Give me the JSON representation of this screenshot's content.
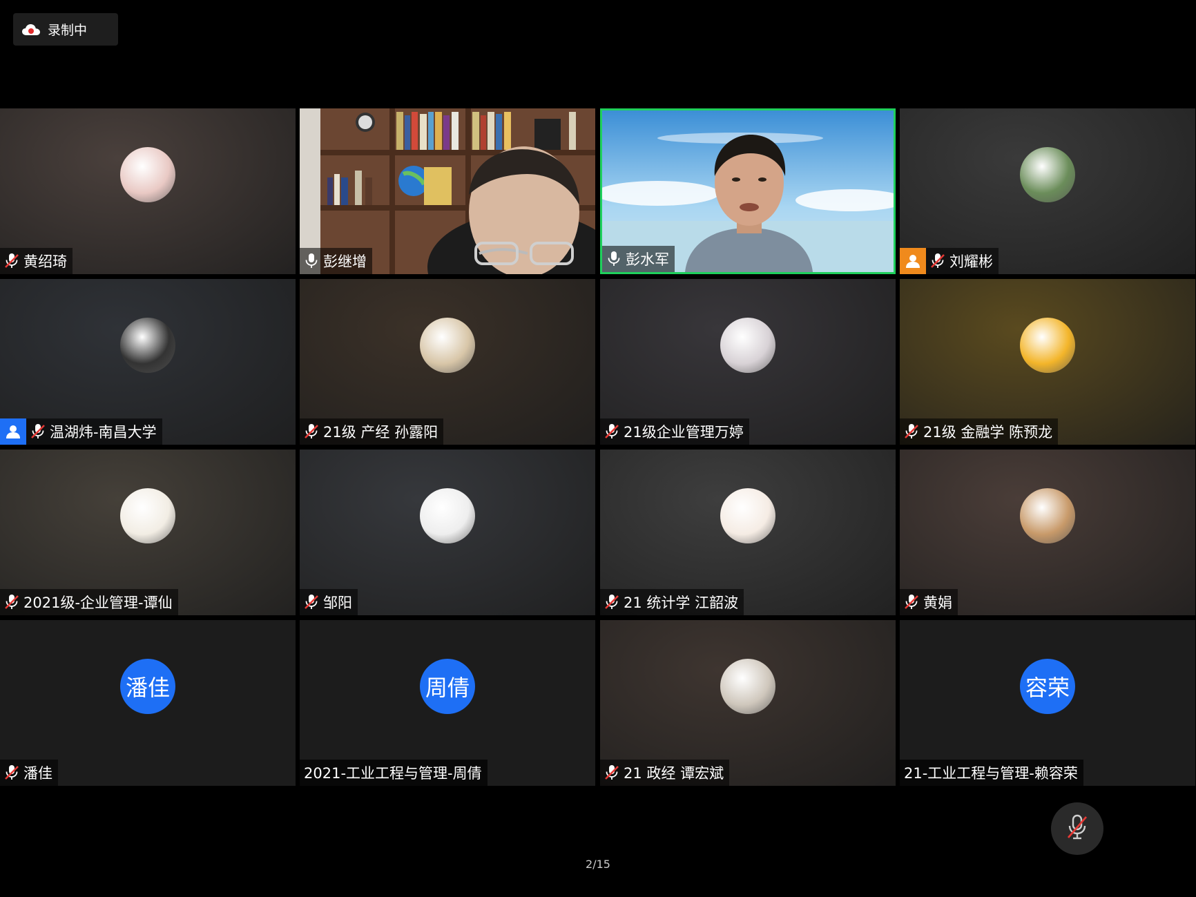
{
  "recording": {
    "label": "录制中",
    "icon": "cloud-record-icon",
    "accent": "#e02b2b"
  },
  "active_speaker_color": "#1fd05c",
  "tiles": [
    {
      "name": "黄绍琦",
      "mic": "muted",
      "kind": "avatar",
      "bg": "#4a403c",
      "avatar_color": "#e9c9c4",
      "role": ""
    },
    {
      "name": "彭继增",
      "mic": "on",
      "kind": "video",
      "bg": "#5a3f2d",
      "role": ""
    },
    {
      "name": "彭水军",
      "mic": "on",
      "kind": "video",
      "bg": "#4f9bd8",
      "active": true,
      "role": ""
    },
    {
      "name": "刘耀彬",
      "mic": "muted",
      "kind": "avatar",
      "bg": "#3a3a3a",
      "avatar_color": "#6b8d5a",
      "role": "host"
    },
    {
      "name": "温湖炜-南昌大学",
      "mic": "muted",
      "kind": "avatar",
      "bg": "#2f3237",
      "avatar_color": "#333",
      "role": "cohost"
    },
    {
      "name": "21级 产经 孙露阳",
      "mic": "muted",
      "kind": "avatar",
      "bg": "#3b3128",
      "avatar_color": "#d8c6a8",
      "role": ""
    },
    {
      "name": "21级企业管理万婷",
      "mic": "muted",
      "kind": "avatar",
      "bg": "#38363a",
      "avatar_color": "#d8d2d6",
      "role": ""
    },
    {
      "name": "21级 金融学 陈预龙",
      "mic": "muted",
      "kind": "avatar",
      "bg": "#5a4a1f",
      "avatar_color": "#f3b52a",
      "role": ""
    },
    {
      "name": "2021级-企业管理-谭仙",
      "mic": "muted",
      "kind": "avatar",
      "bg": "#454039",
      "avatar_color": "#f2ede4",
      "role": ""
    },
    {
      "name": "邹阳",
      "mic": "muted",
      "kind": "avatar",
      "bg": "#36383c",
      "avatar_color": "#eee",
      "role": ""
    },
    {
      "name": "21 统计学 江韶波",
      "mic": "muted",
      "kind": "avatar",
      "bg": "#3e3e3e",
      "avatar_color": "#f5ece4",
      "role": ""
    },
    {
      "name": "黄娟",
      "mic": "muted",
      "kind": "avatar",
      "bg": "#4a3d38",
      "avatar_color": "#c89a6a",
      "role": ""
    },
    {
      "name": "潘佳",
      "mic": "muted",
      "kind": "text",
      "bg": "#1c1c1c",
      "avatar_text": "潘佳",
      "role": ""
    },
    {
      "name": "2021-工业工程与管理-周倩",
      "mic": "none",
      "kind": "text",
      "bg": "#1c1c1c",
      "avatar_text": "周倩",
      "role": ""
    },
    {
      "name": "21 政经 谭宏斌",
      "mic": "muted",
      "kind": "avatar",
      "bg": "#3e3530",
      "avatar_color": "#cfc7bc",
      "role": ""
    },
    {
      "name": "21-工业工程与管理-赖容荣",
      "mic": "none",
      "kind": "text",
      "bg": "#1c1c1c",
      "avatar_text": "容荣",
      "role": ""
    }
  ],
  "mute_button": {
    "icon": "mic-off-icon"
  },
  "pager": {
    "text": "2/15"
  }
}
